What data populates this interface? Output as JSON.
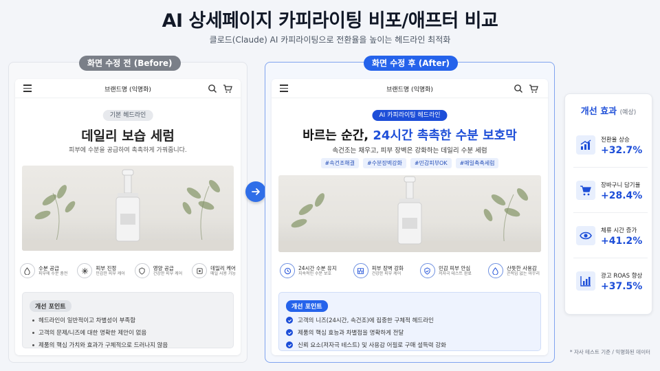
{
  "header": {
    "title": "AI 상세페이지 카피라이팅 비포/애프터 비교",
    "subtitle": "클로드(Claude) AI 카피라이팅으로 전환율을 높이는 헤드라인 최적화"
  },
  "before": {
    "label": "화면 수정 전 (Before)",
    "brand": "브랜드명 (익명화)",
    "tag": "기본 헤드라인",
    "headline": "데일리 보습 세럼",
    "subcopy": "피부에 수분을 공급하여 촉촉하게 가꿔줍니다.",
    "features": [
      {
        "icon": "water-drop-icon",
        "title": "수분 공급",
        "desc": "피부에 수분 충전"
      },
      {
        "icon": "soothing-icon",
        "title": "피부 진정",
        "desc": "민감한 피부 케어"
      },
      {
        "icon": "shield-icon",
        "title": "영양 공급",
        "desc": "건강한 피부 케어"
      },
      {
        "icon": "daily-icon",
        "title": "데일리 케어",
        "desc": "매일 사용 가능"
      }
    ],
    "points_title": "개선 포인트",
    "points": [
      "헤드라인이 일반적이고 차별성이 부족함",
      "고객의 문제/니즈에 대한 명확한 제안이 없음",
      "제품의 핵심 가치와 효과가 구체적으로 드러나지 않음"
    ]
  },
  "after": {
    "label": "화면 수정 후 (After)",
    "brand": "브랜드명 (익명화)",
    "tag": "AI 카피라이팅 헤드라인",
    "headline_part1": "바르는 순간, ",
    "headline_part2": "24시간 촉촉한 수분 보호막",
    "subcopy": "속건조는 채우고, 피부 장벽은 강화하는 데일리 수분 세럼",
    "hashtags": [
      "#속건조해결",
      "#수분장벽강화",
      "#민감피부OK",
      "#매일촉촉세럼"
    ],
    "features": [
      {
        "icon": "clock-icon",
        "title": "24시간 수분 유지",
        "desc": "지속적인 수분 보호"
      },
      {
        "icon": "barrier-icon",
        "title": "피부 장벽 강화",
        "desc": "건강한 피부 케어"
      },
      {
        "icon": "shield-check-icon",
        "title": "민감 피부 안심",
        "desc": "저자극 테스트 완료"
      },
      {
        "icon": "drop-sparkle-icon",
        "title": "산뜻한 사용감",
        "desc": "끈적임 없는 마무리"
      }
    ],
    "points_title": "개선 포인트",
    "points": [
      "고객의 니즈(24시간, 속건조)에 집중한 구체적 헤드라인",
      "제품의 핵심 효능과 차별점을 명확하게 전달",
      "신뢰 요소(저자극 테스트) 및 사용감 어필로 구매 설득력 강화"
    ]
  },
  "effects": {
    "title": "개선 효과",
    "title_note": "(예상)",
    "metrics": [
      {
        "icon": "growth-chart-icon",
        "label": "전환율 상승",
        "value": "+32.7%"
      },
      {
        "icon": "cart-icon",
        "label": "장바구니 담기율",
        "value": "+28.4%"
      },
      {
        "icon": "eye-icon",
        "label": "체류 시간 증가",
        "value": "+41.2%"
      },
      {
        "icon": "bar-chart-icon",
        "label": "광고 ROAS 향상",
        "value": "+37.5%"
      }
    ]
  },
  "footnote": "* 자사 테스트 기준 / 익명화된 데이터",
  "colors": {
    "accent": "#2563eb",
    "before_label": "#7a7f88",
    "background": "#f3f5f9"
  }
}
